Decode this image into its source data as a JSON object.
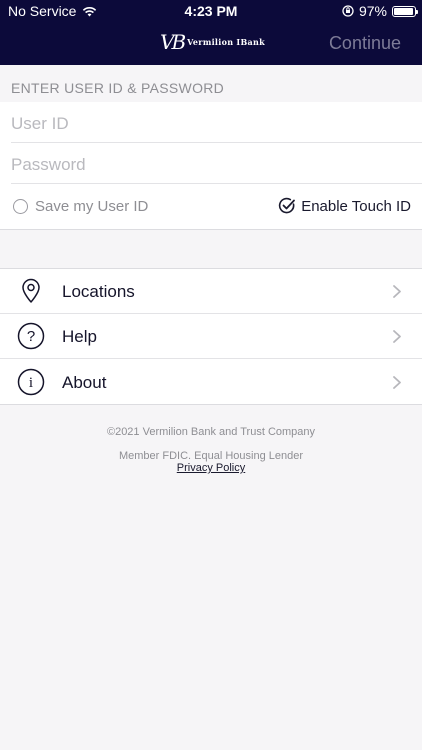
{
  "status_bar": {
    "carrier": "No Service",
    "time": "4:23 PM",
    "battery_percent": "97%",
    "battery_level": 0.97
  },
  "nav": {
    "logo_mark": "VB",
    "brand": "Vermilion IBank",
    "continue_label": "Continue"
  },
  "login": {
    "section_title": "ENTER USER ID & PASSWORD",
    "user_id_placeholder": "User ID",
    "password_placeholder": "Password",
    "save_user_id_label": "Save my User ID",
    "touch_id_label": "Enable Touch ID"
  },
  "menu": {
    "items": [
      {
        "label": "Locations",
        "icon": "location-pin-icon"
      },
      {
        "label": "Help",
        "icon": "question-circle-icon"
      },
      {
        "label": "About",
        "icon": "info-circle-icon"
      }
    ]
  },
  "footer": {
    "copyright": "©2021 Vermilion Bank and Trust Company",
    "member": "Member FDIC. Equal Housing Lender",
    "privacy_link": "Privacy Policy"
  },
  "colors": {
    "header_bg": "#0c0a3a",
    "page_bg": "#f6f5f7",
    "muted_text": "#8e8e93",
    "continue_disabled": "#7d7b97"
  }
}
